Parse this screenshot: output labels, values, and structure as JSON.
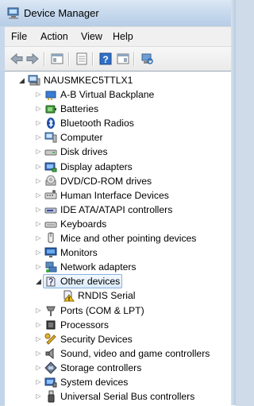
{
  "window": {
    "title": "Device Manager"
  },
  "menu": [
    "File",
    "Action",
    "View",
    "Help"
  ],
  "toolbar": {
    "buttons": [
      "back-arrow-icon",
      "forward-arrow-icon",
      "console-tree-icon",
      "properties-icon",
      "help-icon",
      "show-view-icon",
      "scan-hardware-icon"
    ]
  },
  "tree": {
    "root": "NAUSMKEC5TTLX1",
    "categories": [
      "A-B Virtual Backplane",
      "Batteries",
      "Bluetooth Radios",
      "Computer",
      "Disk drives",
      "Display adapters",
      "DVD/CD-ROM drives",
      "Human Interface Devices",
      "IDE ATA/ATAPI controllers",
      "Keyboards",
      "Mice and other pointing devices",
      "Monitors",
      "Network adapters",
      "Other devices",
      "Ports (COM & LPT)",
      "Processors",
      "Security Devices",
      "Sound, video and game controllers",
      "Storage controllers",
      "System devices",
      "Universal Serial Bus controllers"
    ],
    "other_devices_child": "RNDIS Serial"
  }
}
